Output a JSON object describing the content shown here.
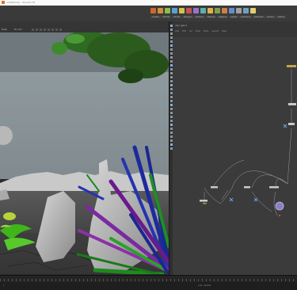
{
  "app": {
    "window_title": "untitled.hip - Houdini FX",
    "colors": {
      "accent": "#e06a1b",
      "viewport_sky": "#8a979c",
      "viewport_ground": "#3c3c3c",
      "network_bg": "#3b3b3b"
    }
  },
  "menubar": {
    "shelf_tools": [
      "create-icon",
      "polygon-icon",
      "deform-icon",
      "texture-icon",
      "rigging-icon",
      "muscles-icon",
      "characters-icon",
      "constraints-icon",
      "hair-icon",
      "terrain-icon",
      "crowds-icon",
      "drive-icon",
      "cloud-icon",
      "volume-icon",
      "lights-icon"
    ],
    "shelf_tabs": [
      "Create",
      "Modify",
      "Model",
      "Polygon",
      "Deform",
      "Texture",
      "Rigging",
      "Lights",
      "Collisions",
      "Particles",
      "Grains",
      "Vellum"
    ]
  },
  "viewport": {
    "camera_menu": "Persp",
    "display_menu": "No cam",
    "toolbar_icons": [
      "view-icon",
      "camera-icon",
      "snap-icon",
      "wireframe-icon",
      "shade-icon",
      "light-icon",
      "grid-icon",
      "display-icon"
    ]
  },
  "network": {
    "path": "obj / geo1",
    "menus": [
      "Add",
      "Edit",
      "Go",
      "View",
      "Tools",
      "Layout",
      "Help"
    ],
    "nodes": [
      {
        "label": "grid1"
      },
      {
        "label": "scatter1"
      },
      {
        "label": "copy1"
      },
      {
        "label": "merge1"
      },
      {
        "label": "rock_01"
      },
      {
        "label": "rock_02"
      },
      {
        "label": "plants"
      },
      {
        "label": "OUT"
      }
    ]
  },
  "timeline": {
    "frame": "1",
    "range_start": "1",
    "range_end": "240"
  },
  "status": {
    "keys": "Auto Update"
  }
}
